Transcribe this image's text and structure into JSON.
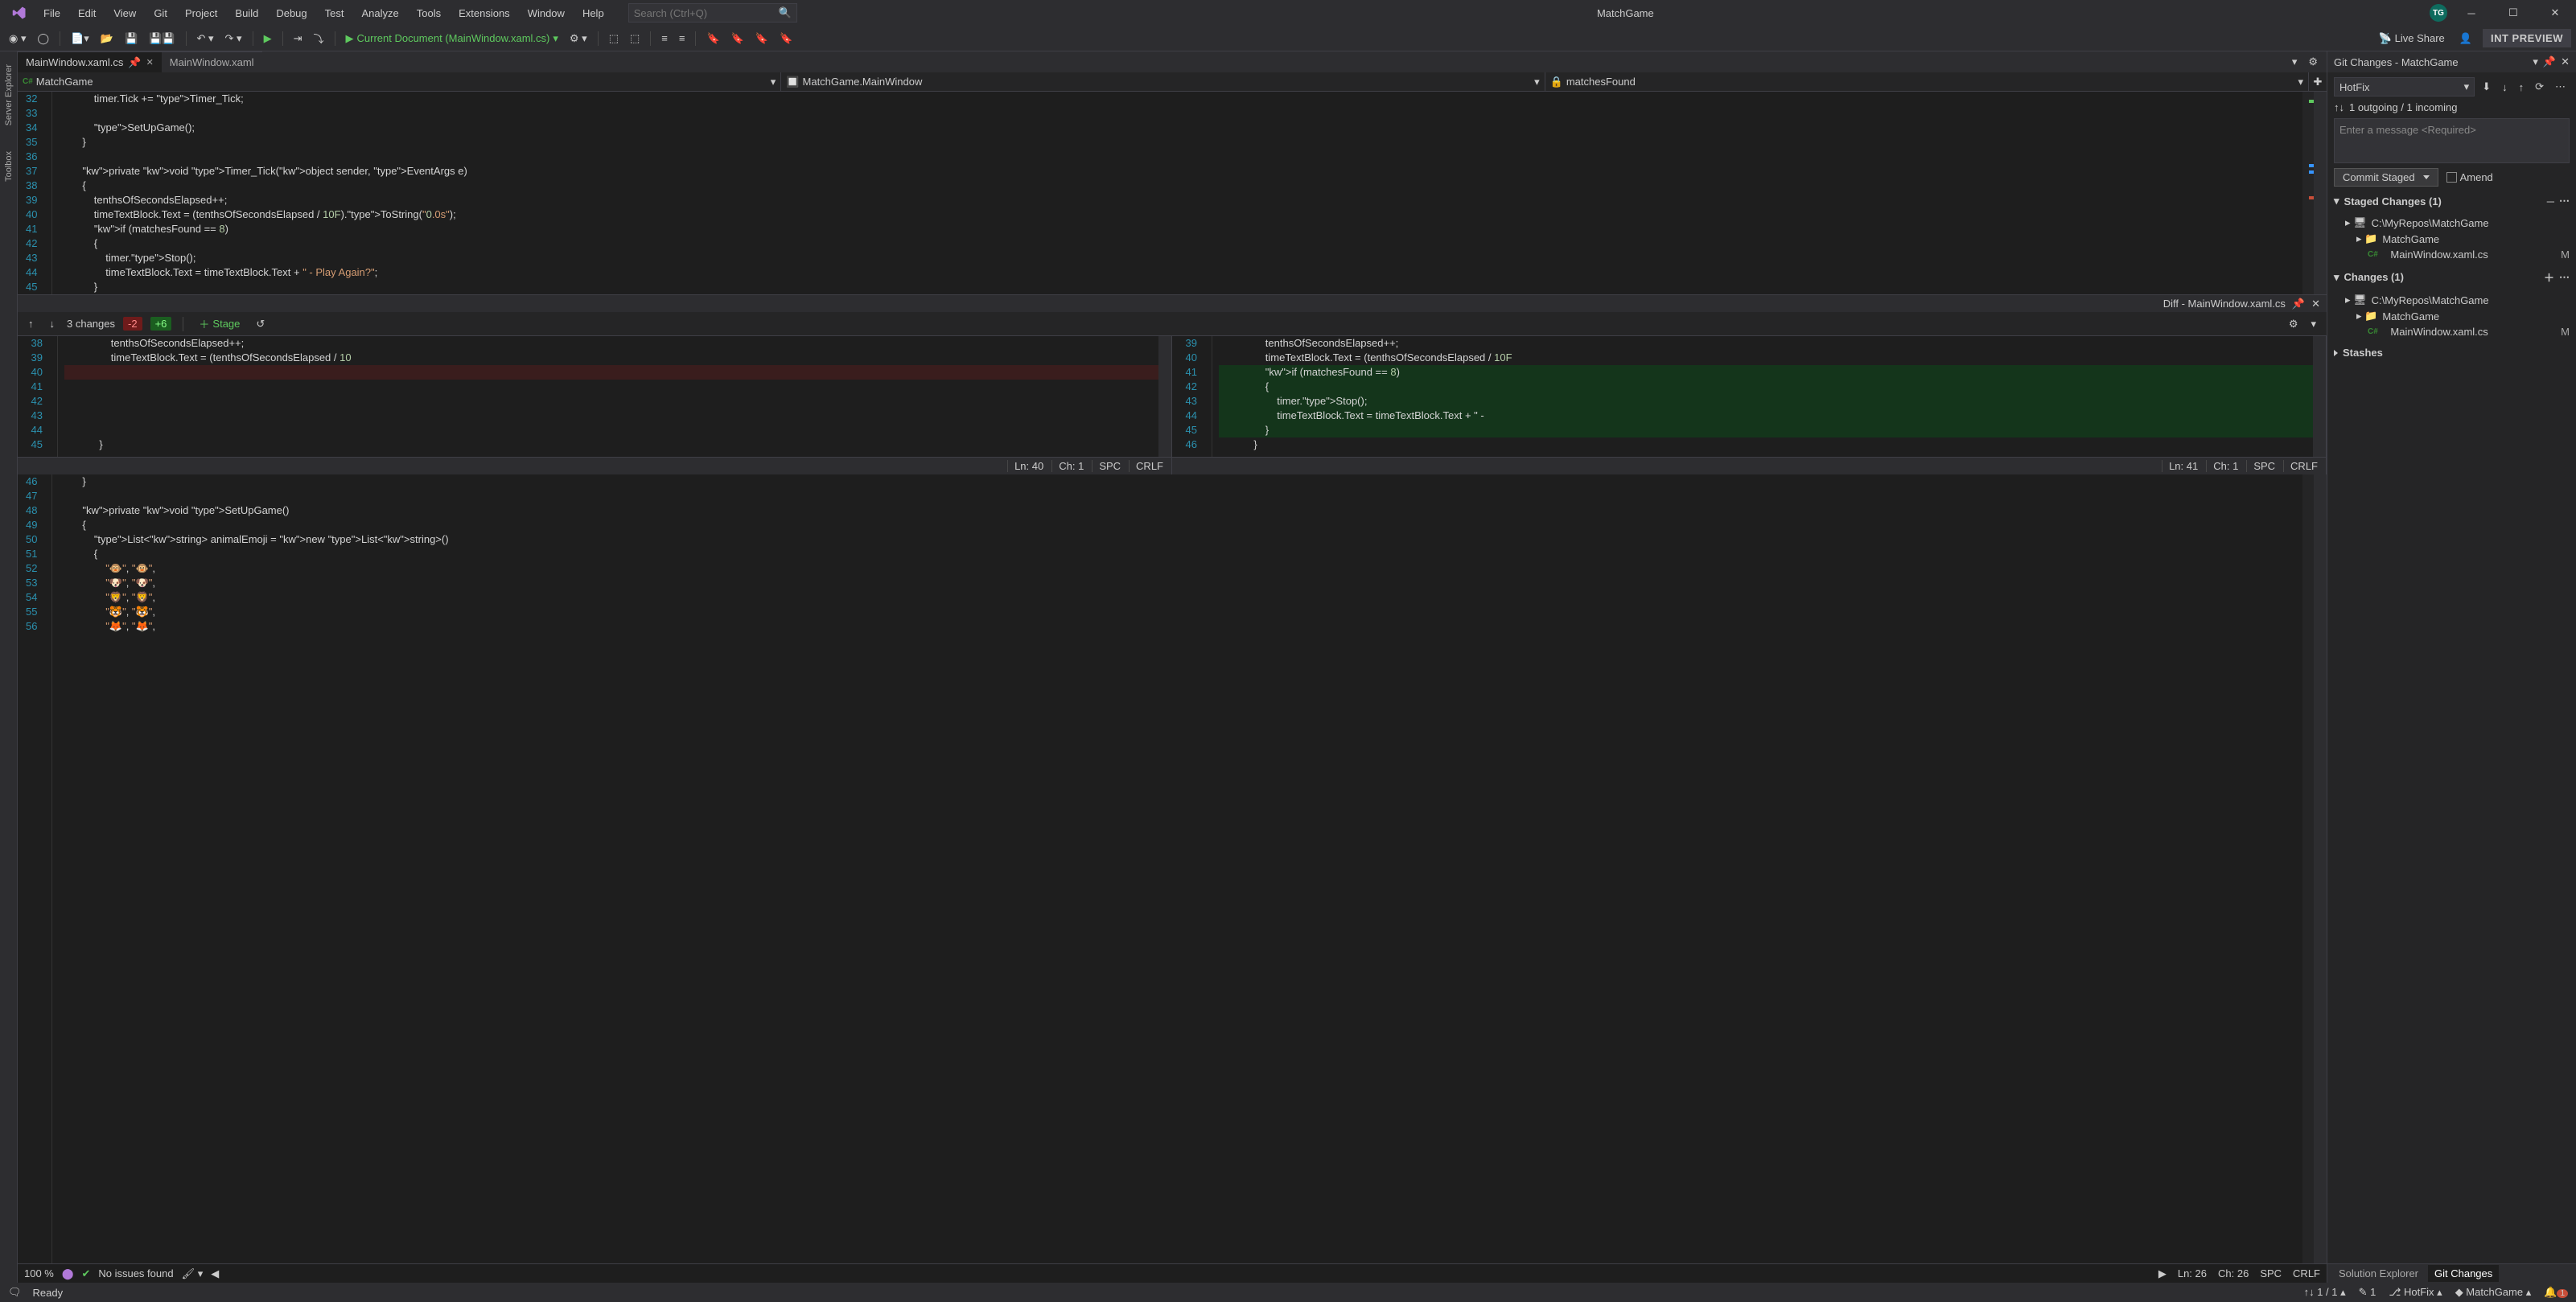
{
  "menu": [
    "File",
    "Edit",
    "View",
    "Git",
    "Project",
    "Build",
    "Debug",
    "Test",
    "Analyze",
    "Tools",
    "Extensions",
    "Window",
    "Help"
  ],
  "search_placeholder": "Search (Ctrl+Q)",
  "solution_name": "MatchGame",
  "avatar_initials": "TG",
  "toolbar": {
    "current_doc": "Current Document (MainWindow.xaml.cs)",
    "live_share": "Live Share",
    "int_preview": "INT PREVIEW"
  },
  "sidetabs": [
    "Server Explorer",
    "Toolbox"
  ],
  "tabs": [
    {
      "label": "MainWindow.xaml.cs",
      "active": true
    },
    {
      "label": "MainWindow.xaml",
      "active": false
    }
  ],
  "nav": {
    "ns": "MatchGame",
    "cls": "MatchGame.MainWindow",
    "member": "matchesFound"
  },
  "code_main": {
    "start": 32,
    "lines": [
      "            timer.Tick += Timer_Tick;",
      "",
      "            SetUpGame();",
      "        }",
      "",
      "        private void Timer_Tick(object sender, EventArgs e)",
      "        {",
      "            tenthsOfSecondsElapsed++;",
      "            timeTextBlock.Text = (tenthsOfSecondsElapsed / 10F).ToString(\"0.0s\");",
      "            if (matchesFound == 8)",
      "            {",
      "                timer.Stop();",
      "                timeTextBlock.Text = timeTextBlock.Text + \" - Play Again?\";",
      "            }"
    ]
  },
  "code_lower": {
    "start": 46,
    "lines": [
      "        }",
      "",
      "        private void SetUpGame()",
      "        {",
      "            List<string> animalEmoji = new List<string>()",
      "            {",
      "                \"🐵\", \"🐵\",",
      "                \"🐶\", \"🐶\",",
      "                \"🦁\", \"🦁\",",
      "                \"🐯\", \"🐯\",",
      "                \"🦊\", \"🦊\","
    ]
  },
  "diff": {
    "title": "Diff - MainWindow.xaml.cs",
    "changes_label": "3 changes",
    "minus": "-2",
    "plus": "+6",
    "stage": "Stage",
    "left": {
      "start": 38,
      "lines": [
        "                tenthsOfSecondsElapsed++;",
        "                timeTextBlock.Text = (tenthsOfSecondsElapsed / 10",
        "",
        "",
        "",
        "",
        "",
        "            }"
      ],
      "removed_idx": [
        2
      ],
      "status": {
        "ln": "Ln: 40",
        "ch": "Ch: 1",
        "spc": "SPC",
        "crlf": "CRLF"
      }
    },
    "right": {
      "start": 39,
      "lines": [
        "                tenthsOfSecondsElapsed++;",
        "                timeTextBlock.Text = (tenthsOfSecondsElapsed / 10F",
        "                if (matchesFound == 8)",
        "                {",
        "                    timer.Stop();",
        "                    timeTextBlock.Text = timeTextBlock.Text + \" - ",
        "                }",
        "            }"
      ],
      "added_idx": [
        2,
        3,
        4,
        5,
        6
      ],
      "status": {
        "ln": "Ln: 41",
        "ch": "Ch: 1",
        "spc": "SPC",
        "crlf": "CRLF"
      }
    }
  },
  "git": {
    "title": "Git Changes - MatchGame",
    "branch": "HotFix",
    "sync": "1 outgoing / 1 incoming",
    "msg_placeholder": "Enter a message <Required>",
    "commit_label": "Commit Staged",
    "amend": "Amend",
    "staged": {
      "label": "Staged Changes (1)",
      "repo": "C:\\MyRepos\\MatchGame",
      "proj": "MatchGame",
      "file": "MainWindow.xaml.cs",
      "status": "M"
    },
    "changes": {
      "label": "Changes (1)",
      "repo": "C:\\MyRepos\\MatchGame",
      "proj": "MatchGame",
      "file": "MainWindow.xaml.cs",
      "status": "M"
    },
    "stashes": "Stashes"
  },
  "panel_tabs": [
    "Solution Explorer",
    "Git Changes"
  ],
  "bottombar": {
    "zoom": "100 %",
    "issues": "No issues found",
    "ln": "Ln: 26",
    "ch": "Ch: 26",
    "spc": "SPC",
    "crlf": "CRLF"
  },
  "status": {
    "ready": "Ready",
    "sync": "1 / 1",
    "pencil": "1",
    "branch": "HotFix",
    "repo": "MatchGame",
    "bell": "1"
  }
}
